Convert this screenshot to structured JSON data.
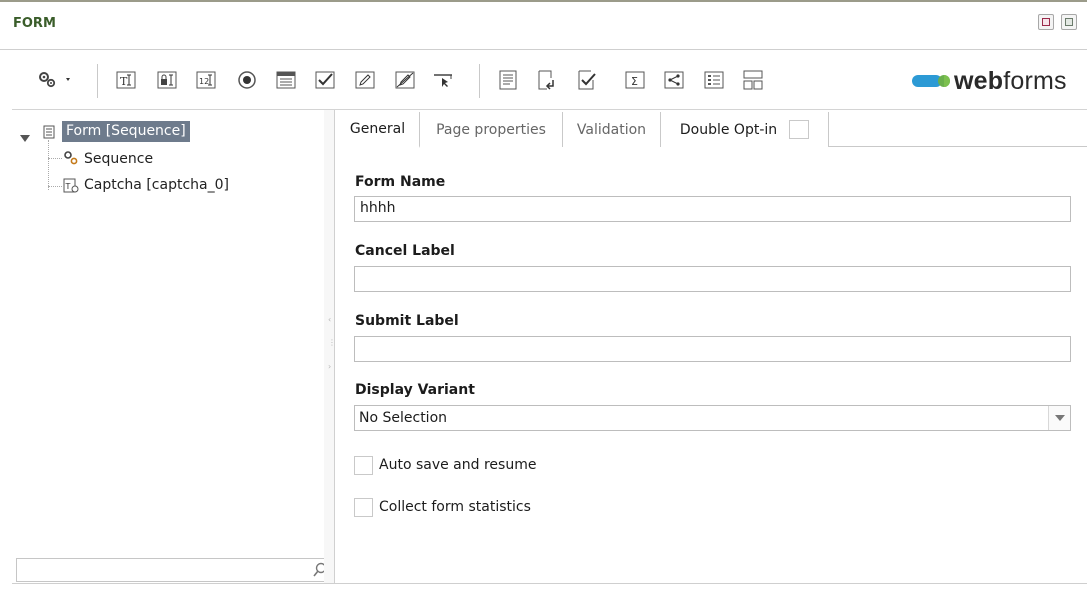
{
  "window": {
    "title": "FORM"
  },
  "toolbar": {
    "icons": [
      "settings-dropdown-icon",
      "text-field-icon",
      "password-field-icon",
      "numeric-field-icon",
      "radio-button-icon",
      "select-list-icon",
      "checkbox-icon",
      "edit-field-icon",
      "hidden-field-icon",
      "link-pointer-icon",
      "text-block-icon",
      "page-break-icon",
      "check-field-icon",
      "sum-calculation-icon",
      "share-icon",
      "list-form-icon",
      "layout-grid-icon"
    ],
    "logo_text_bold": "web",
    "logo_text_light": "forms",
    "logo_colors": [
      "#2c9ad5",
      "#6ab04c"
    ]
  },
  "tree": {
    "items": [
      {
        "label": "Form [Sequence]",
        "icon": "form-document-icon",
        "selected": true
      },
      {
        "label": "Sequence",
        "icon": "sequence-gears-icon",
        "selected": false
      },
      {
        "label": "Captcha [captcha_0]",
        "icon": "captcha-icon",
        "selected": false
      }
    ],
    "search_placeholder": ""
  },
  "tabs": [
    {
      "label": "General",
      "active": true
    },
    {
      "label": "Page properties",
      "active": false
    },
    {
      "label": "Validation",
      "active": false
    },
    {
      "label": "Double Opt-in",
      "active": false
    }
  ],
  "form": {
    "form_name_label": "Form Name",
    "form_name_value": "hhhh",
    "cancel_label_label": "Cancel Label",
    "cancel_label_value": "",
    "submit_label_label": "Submit Label",
    "submit_label_value": "",
    "display_variant_label": "Display Variant",
    "display_variant_value": "No Selection",
    "auto_save_label": "Auto save and resume",
    "collect_stats_label": "Collect form statistics"
  }
}
